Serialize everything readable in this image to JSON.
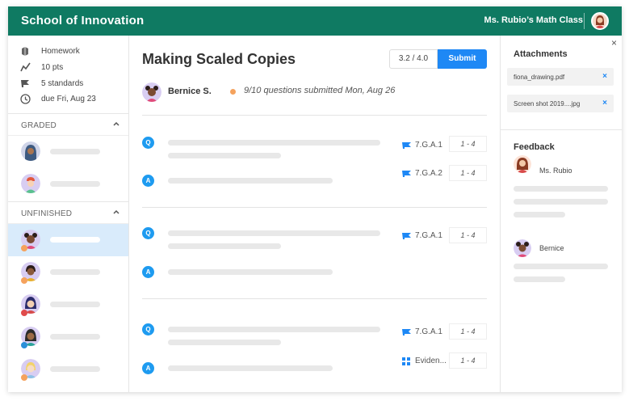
{
  "header": {
    "brand": "School of Innovation",
    "class_name": "Ms. Rubio’s Math Class"
  },
  "sidebar": {
    "meta": [
      {
        "icon": "book-icon",
        "label": "Homework"
      },
      {
        "icon": "trend-icon",
        "label": "10 pts"
      },
      {
        "icon": "flag-icon",
        "label": "5 standards"
      },
      {
        "icon": "clock-icon",
        "label": "due Fri, Aug 23"
      }
    ],
    "graded_label": "GRADED",
    "unfinished_label": "UNFINISHED"
  },
  "main": {
    "title": "Making Scaled Copies",
    "score": "3.2 / 4.0",
    "submit_label": "Submit",
    "student_name": "Bernice S.",
    "status_text": "9/10 questions submitted Mon, Aug 26",
    "q_badge": "Q",
    "a_badge": "A",
    "rows": [
      {
        "std1": "7.G.A.1",
        "range1": "1 - 4",
        "std2": "7.G.A.2",
        "range2": "1 - 4"
      },
      {
        "std1": "7.G.A.1",
        "range1": "1 - 4"
      },
      {
        "std1": "7.G.A.1",
        "range1": "1 - 4",
        "std2": "Eviden...",
        "range2": "1 - 4"
      }
    ]
  },
  "right": {
    "close": "×",
    "attachments_title": "Attachments",
    "attachments": [
      {
        "name": "fiona_drawing.pdf",
        "remove": "×"
      },
      {
        "name": "Screen shot 2019....jpg",
        "remove": "×"
      }
    ],
    "feedback_title": "Feedback",
    "feedback": [
      {
        "name": "Ms. Rubio"
      },
      {
        "name": "Bernice"
      }
    ]
  },
  "colors": {
    "brand": "#0f7a62",
    "accent": "#1e88f5",
    "selected_row": "#d9ebfb",
    "status_dot": "#f5a25d"
  }
}
